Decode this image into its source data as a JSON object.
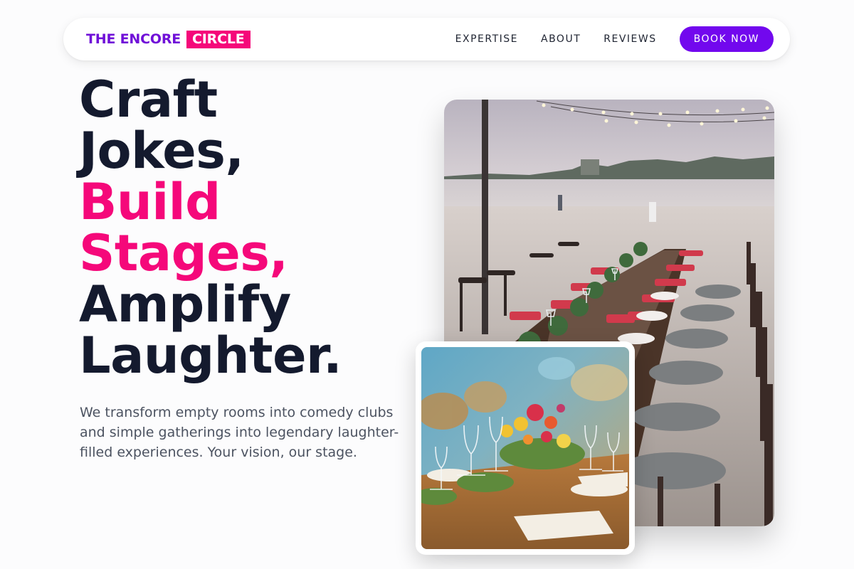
{
  "brand": {
    "name_part1": "THE ENCORE",
    "name_part2": "CIRCLE"
  },
  "nav": {
    "links": [
      "EXPERTISE",
      "ABOUT",
      "REVIEWS"
    ],
    "cta": "BOOK NOW"
  },
  "hero": {
    "title_lines": [
      "Craft",
      "Jokes,",
      "Build",
      "Stages,",
      "Amplify",
      "Laughter."
    ],
    "highlight_lines": [
      "Build",
      "Stages,"
    ],
    "subtitle": "We transform empty rooms into comedy clubs and simple gatherings into legendary laughter-filled experiences. Your vision, our stage."
  },
  "images": {
    "main": "beach-dinner-long-table-photo",
    "inset": "table-setting-flowers-glasses-photo"
  },
  "colors": {
    "brand_purple": "#7010d8",
    "brand_pink": "#f5087a",
    "cta_purple": "#7208ee",
    "heading_dark": "#141a2e",
    "body_gray": "#4c5361"
  }
}
